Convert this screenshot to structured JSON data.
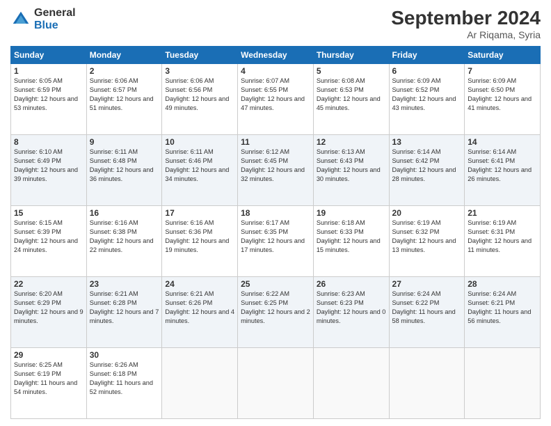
{
  "logo": {
    "general": "General",
    "blue": "Blue"
  },
  "header": {
    "month": "September 2024",
    "location": "Ar Riqama, Syria"
  },
  "weekdays": [
    "Sunday",
    "Monday",
    "Tuesday",
    "Wednesday",
    "Thursday",
    "Friday",
    "Saturday"
  ],
  "weeks": [
    [
      {
        "day": "1",
        "info": "Sunrise: 6:05 AM\nSunset: 6:59 PM\nDaylight: 12 hours and 53 minutes."
      },
      {
        "day": "2",
        "info": "Sunrise: 6:06 AM\nSunset: 6:57 PM\nDaylight: 12 hours and 51 minutes."
      },
      {
        "day": "3",
        "info": "Sunrise: 6:06 AM\nSunset: 6:56 PM\nDaylight: 12 hours and 49 minutes."
      },
      {
        "day": "4",
        "info": "Sunrise: 6:07 AM\nSunset: 6:55 PM\nDaylight: 12 hours and 47 minutes."
      },
      {
        "day": "5",
        "info": "Sunrise: 6:08 AM\nSunset: 6:53 PM\nDaylight: 12 hours and 45 minutes."
      },
      {
        "day": "6",
        "info": "Sunrise: 6:09 AM\nSunset: 6:52 PM\nDaylight: 12 hours and 43 minutes."
      },
      {
        "day": "7",
        "info": "Sunrise: 6:09 AM\nSunset: 6:50 PM\nDaylight: 12 hours and 41 minutes."
      }
    ],
    [
      {
        "day": "8",
        "info": "Sunrise: 6:10 AM\nSunset: 6:49 PM\nDaylight: 12 hours and 39 minutes."
      },
      {
        "day": "9",
        "info": "Sunrise: 6:11 AM\nSunset: 6:48 PM\nDaylight: 12 hours and 36 minutes."
      },
      {
        "day": "10",
        "info": "Sunrise: 6:11 AM\nSunset: 6:46 PM\nDaylight: 12 hours and 34 minutes."
      },
      {
        "day": "11",
        "info": "Sunrise: 6:12 AM\nSunset: 6:45 PM\nDaylight: 12 hours and 32 minutes."
      },
      {
        "day": "12",
        "info": "Sunrise: 6:13 AM\nSunset: 6:43 PM\nDaylight: 12 hours and 30 minutes."
      },
      {
        "day": "13",
        "info": "Sunrise: 6:14 AM\nSunset: 6:42 PM\nDaylight: 12 hours and 28 minutes."
      },
      {
        "day": "14",
        "info": "Sunrise: 6:14 AM\nSunset: 6:41 PM\nDaylight: 12 hours and 26 minutes."
      }
    ],
    [
      {
        "day": "15",
        "info": "Sunrise: 6:15 AM\nSunset: 6:39 PM\nDaylight: 12 hours and 24 minutes."
      },
      {
        "day": "16",
        "info": "Sunrise: 6:16 AM\nSunset: 6:38 PM\nDaylight: 12 hours and 22 minutes."
      },
      {
        "day": "17",
        "info": "Sunrise: 6:16 AM\nSunset: 6:36 PM\nDaylight: 12 hours and 19 minutes."
      },
      {
        "day": "18",
        "info": "Sunrise: 6:17 AM\nSunset: 6:35 PM\nDaylight: 12 hours and 17 minutes."
      },
      {
        "day": "19",
        "info": "Sunrise: 6:18 AM\nSunset: 6:33 PM\nDaylight: 12 hours and 15 minutes."
      },
      {
        "day": "20",
        "info": "Sunrise: 6:19 AM\nSunset: 6:32 PM\nDaylight: 12 hours and 13 minutes."
      },
      {
        "day": "21",
        "info": "Sunrise: 6:19 AM\nSunset: 6:31 PM\nDaylight: 12 hours and 11 minutes."
      }
    ],
    [
      {
        "day": "22",
        "info": "Sunrise: 6:20 AM\nSunset: 6:29 PM\nDaylight: 12 hours and 9 minutes."
      },
      {
        "day": "23",
        "info": "Sunrise: 6:21 AM\nSunset: 6:28 PM\nDaylight: 12 hours and 7 minutes."
      },
      {
        "day": "24",
        "info": "Sunrise: 6:21 AM\nSunset: 6:26 PM\nDaylight: 12 hours and 4 minutes."
      },
      {
        "day": "25",
        "info": "Sunrise: 6:22 AM\nSunset: 6:25 PM\nDaylight: 12 hours and 2 minutes."
      },
      {
        "day": "26",
        "info": "Sunrise: 6:23 AM\nSunset: 6:23 PM\nDaylight: 12 hours and 0 minutes."
      },
      {
        "day": "27",
        "info": "Sunrise: 6:24 AM\nSunset: 6:22 PM\nDaylight: 11 hours and 58 minutes."
      },
      {
        "day": "28",
        "info": "Sunrise: 6:24 AM\nSunset: 6:21 PM\nDaylight: 11 hours and 56 minutes."
      }
    ],
    [
      {
        "day": "29",
        "info": "Sunrise: 6:25 AM\nSunset: 6:19 PM\nDaylight: 11 hours and 54 minutes."
      },
      {
        "day": "30",
        "info": "Sunrise: 6:26 AM\nSunset: 6:18 PM\nDaylight: 11 hours and 52 minutes."
      },
      {
        "day": "",
        "info": ""
      },
      {
        "day": "",
        "info": ""
      },
      {
        "day": "",
        "info": ""
      },
      {
        "day": "",
        "info": ""
      },
      {
        "day": "",
        "info": ""
      }
    ]
  ]
}
